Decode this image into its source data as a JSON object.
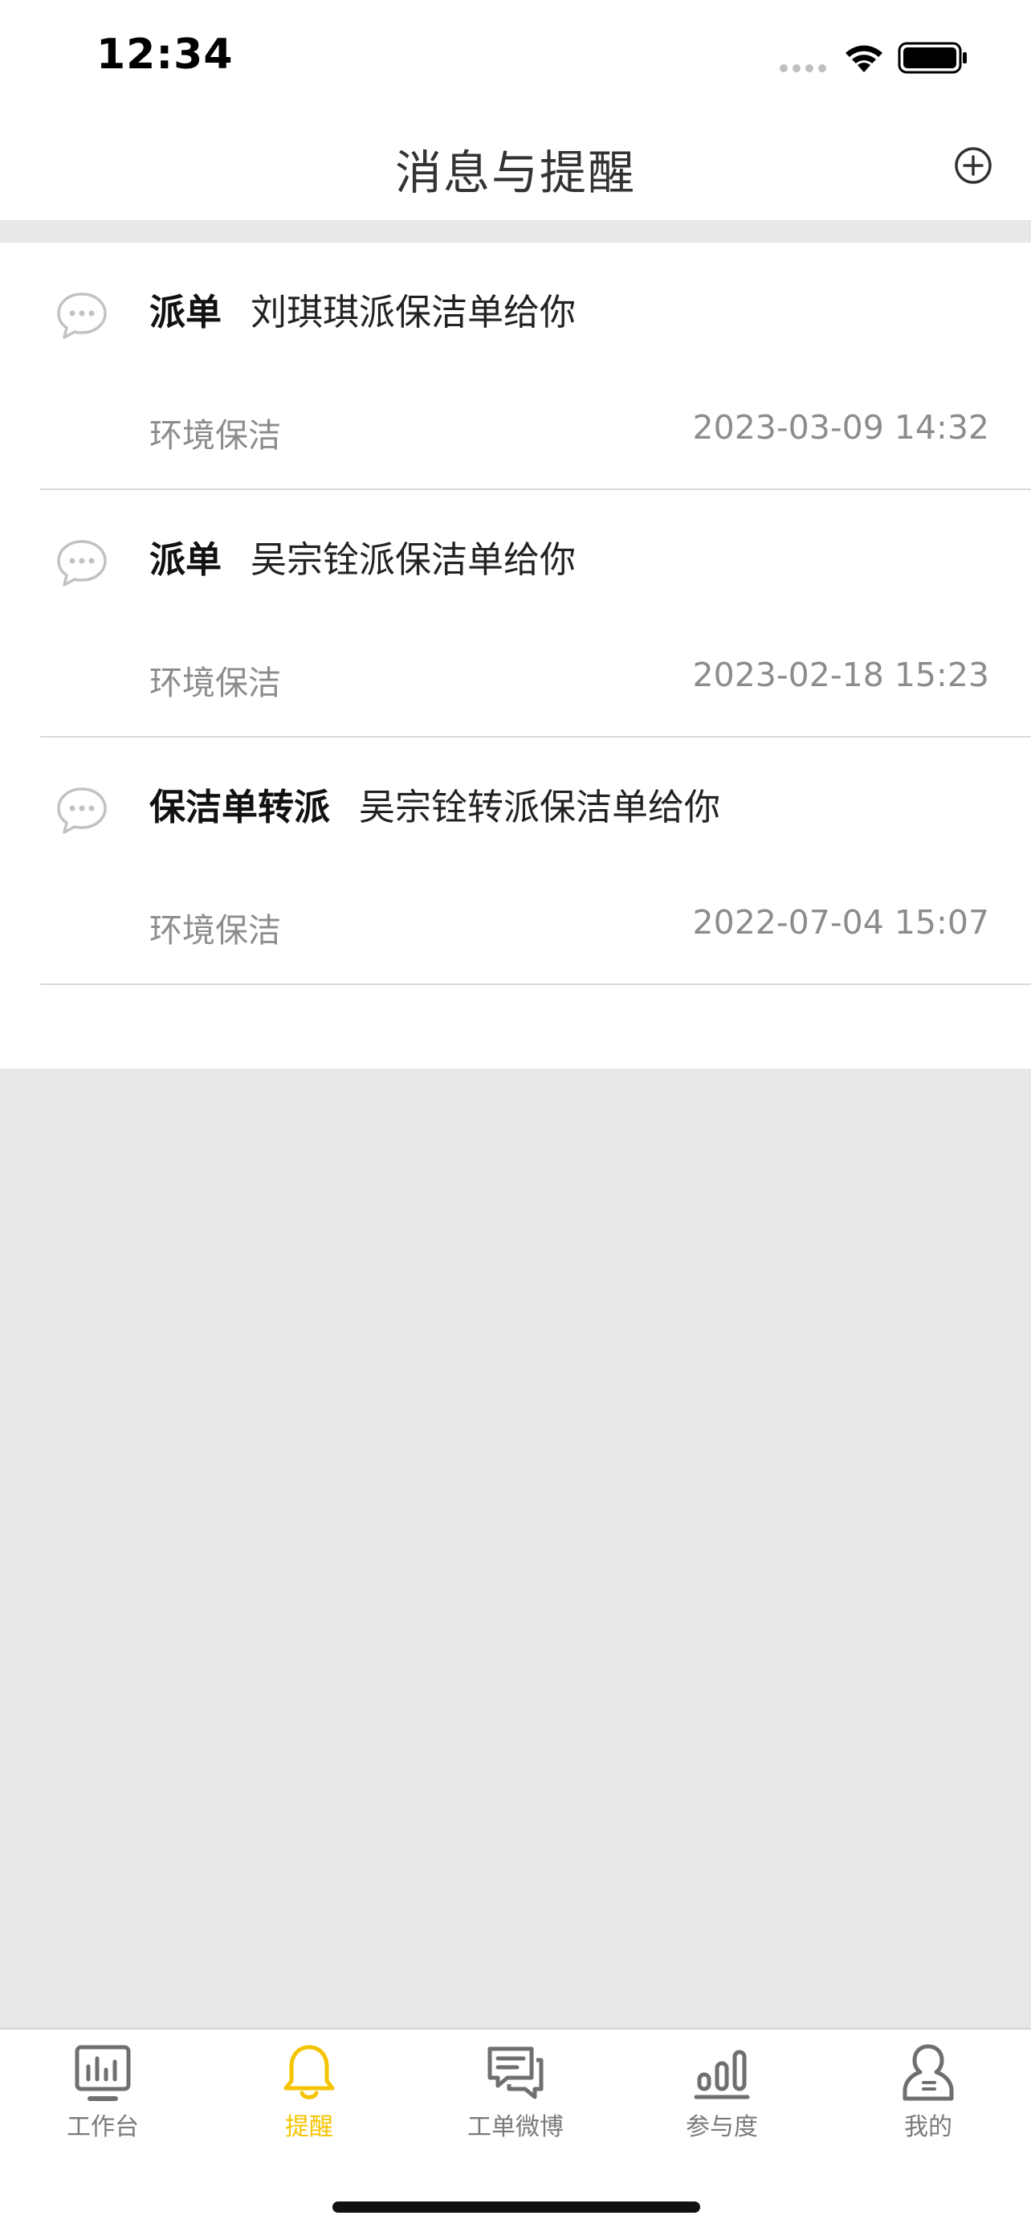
{
  "status_bar": {
    "time": "12:34"
  },
  "nav": {
    "title": "消息与提醒",
    "add_icon": "plus-circle-icon"
  },
  "messages": [
    {
      "type": "派单",
      "text": "刘琪琪派保洁单给你",
      "category": "环境保洁",
      "time": "2023-03-09 14:32"
    },
    {
      "type": "派单",
      "text": "吴宗铨派保洁单给你",
      "category": "环境保洁",
      "time": "2023-02-18 15:23"
    },
    {
      "type": "保洁单转派",
      "text": "吴宗铨转派保洁单给你",
      "category": "环境保洁",
      "time": "2022-07-04 15:07"
    }
  ],
  "tabs": [
    {
      "label": "工作台",
      "icon": "dashboard-icon",
      "active": false
    },
    {
      "label": "提醒",
      "icon": "bell-icon",
      "active": true
    },
    {
      "label": "工单微博",
      "icon": "chat-bubbles-icon",
      "active": false
    },
    {
      "label": "参与度",
      "icon": "bar-chart-icon",
      "active": false
    },
    {
      "label": "我的",
      "icon": "user-icon",
      "active": false
    }
  ],
  "colors": {
    "accent": "#f5c400",
    "tab_inactive": "#7a7a7a",
    "background": "#e8e8e8",
    "secondary_text": "#8c8c8c"
  }
}
